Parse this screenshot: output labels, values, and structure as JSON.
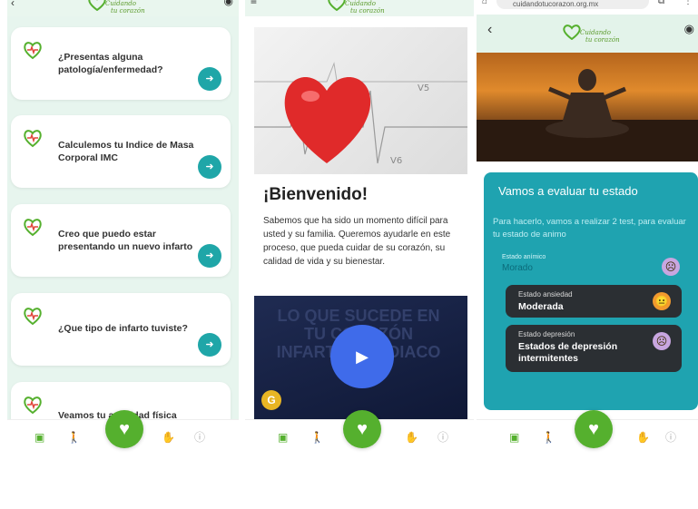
{
  "colors": {
    "teal": "#1fa6a8",
    "green": "#55b02e",
    "mint": "#e7f5ee",
    "panel": "#1fa3b0"
  },
  "brand": {
    "line1": "Cuidando",
    "line2": "tu corazón"
  },
  "screen1": {
    "cards": [
      {
        "text": "¿Presentas alguna patología/enfermedad?",
        "icon": "heart-pulse-icon"
      },
      {
        "text": "Calculemos tu Indice de Masa Corporal IMC",
        "icon": "heart-pulse-icon"
      },
      {
        "text": "Creo que puedo estar presentando un nuevo infarto",
        "icon": "heart-pulse-icon"
      },
      {
        "text": "¿Que tipo de infarto tuviste?",
        "icon": "heart-pulse-icon"
      },
      {
        "text": "Veamos tu actividad física",
        "icon": "heart-pulse-icon"
      }
    ]
  },
  "screen2": {
    "welcome_title": "¡Bienvenido!",
    "welcome_text": "Sabemos que ha sido un momento difícil para usted y su familia. Queremos ayudarle en este proceso, que pueda cuidar de su corazón, su calidad de vida y su bienestar.",
    "video_text": "LO QUE SUCEDE EN TU CORAZÓN INFARTO CARDIACO",
    "badge": "G"
  },
  "screen3": {
    "url": "cuidandotucorazon.org.mx",
    "back": "‹",
    "panel_title": "Vamos a evaluar tu estado",
    "panel_sub": "Para hacerlo, vamos a realizar 2 test, para evaluar tu estado de animo",
    "mood": {
      "label": "Estado anímico",
      "value": "Morado"
    },
    "anxiety": {
      "label": "Estado ansiedad",
      "value": "Moderada"
    },
    "depression": {
      "label": "Estado depresión",
      "value": "Estados de depresión intermitentes"
    }
  },
  "nav": {
    "icons": [
      "clipboard-icon",
      "walking-icon",
      "heart-icon",
      "hand-icon",
      "info-icon"
    ]
  }
}
